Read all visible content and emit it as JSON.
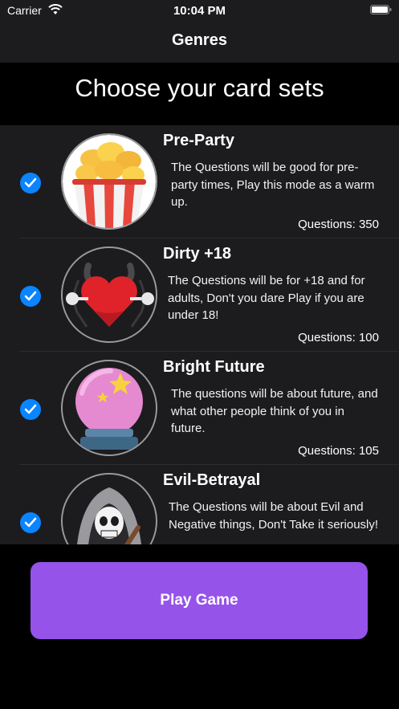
{
  "status_bar": {
    "carrier": "Carrier",
    "time": "10:04 PM",
    "wifi_icon": "wifi-icon",
    "battery_icon": "battery-icon"
  },
  "nav": {
    "title": "Genres"
  },
  "header": {
    "title": "Choose your card sets"
  },
  "genres": [
    {
      "title": "Pre-Party",
      "description": "The Questions will be good for pre-party times, Play this mode as a warm up.",
      "count": "Questions: 350",
      "checked": true,
      "icon": "popcorn-icon"
    },
    {
      "title": "Dirty +18",
      "description": "The Questions will be for +18 and for adults, Don't you dare Play if you are under 18!",
      "count": "Questions: 100",
      "checked": true,
      "icon": "devil-heart-icon"
    },
    {
      "title": "Bright Future",
      "description": "The questions will be about future, and what other people think of you in future.",
      "count": "Questions: 105",
      "checked": true,
      "icon": "crystal-ball-icon"
    },
    {
      "title": "Evil-Betrayal",
      "description": "The Questions will be about Evil and Negative things, Don't Take it seriously!",
      "count": "",
      "checked": true,
      "icon": "grim-reaper-icon"
    }
  ],
  "footer": {
    "play_label": "Play Game"
  },
  "colors": {
    "accent": "#9553ea",
    "check": "#0a84ff",
    "row_bg": "#1c1c1e"
  }
}
